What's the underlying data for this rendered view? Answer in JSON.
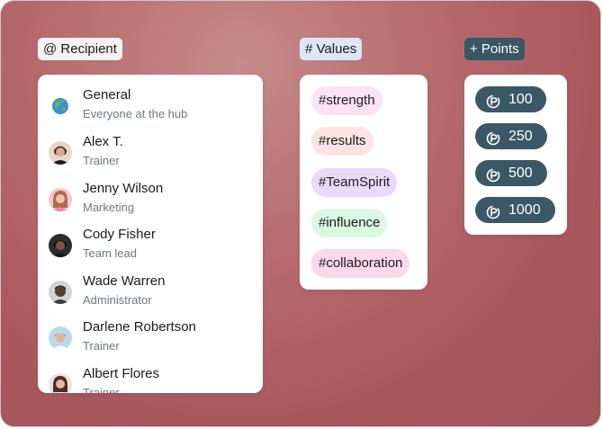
{
  "sections": {
    "recipient_label": "@ Recipient",
    "values_label": "# Values",
    "points_label": "+ Points"
  },
  "recipients": [
    {
      "name": "General",
      "role": "Everyone at the hub",
      "avatar": "globe-icon"
    },
    {
      "name": "Alex T.",
      "role": "Trainer",
      "avatar": "avatar"
    },
    {
      "name": "Jenny Wilson",
      "role": "Marketing",
      "avatar": "avatar"
    },
    {
      "name": "Cody Fisher",
      "role": "Team lead",
      "avatar": "avatar"
    },
    {
      "name": "Wade Warren",
      "role": "Administrator",
      "avatar": "avatar"
    },
    {
      "name": "Darlene Robertson",
      "role": "Trainer",
      "avatar": "avatar"
    },
    {
      "name": "Albert Flores",
      "role": "Trainer",
      "avatar": "avatar"
    }
  ],
  "values": [
    {
      "label": "#strength",
      "color": "#fbe3f3"
    },
    {
      "label": "#results",
      "color": "#fde3e3"
    },
    {
      "label": "#TeamSpirit",
      "color": "#e9d9fb"
    },
    {
      "label": "#influence",
      "color": "#dcf7e3"
    },
    {
      "label": "#collaboration",
      "color": "#fbd8ea"
    }
  ],
  "points": [
    {
      "value": "100",
      "icon": "points-coin-icon"
    },
    {
      "value": "250",
      "icon": "points-coin-icon"
    },
    {
      "value": "500",
      "icon": "points-coin-icon"
    },
    {
      "value": "1000",
      "icon": "points-coin-icon"
    }
  ],
  "colors": {
    "background": "#b06168",
    "points_pill": "#3b5866",
    "values_label_bg": "#dbe7f7",
    "points_label_bg": "#395866"
  }
}
